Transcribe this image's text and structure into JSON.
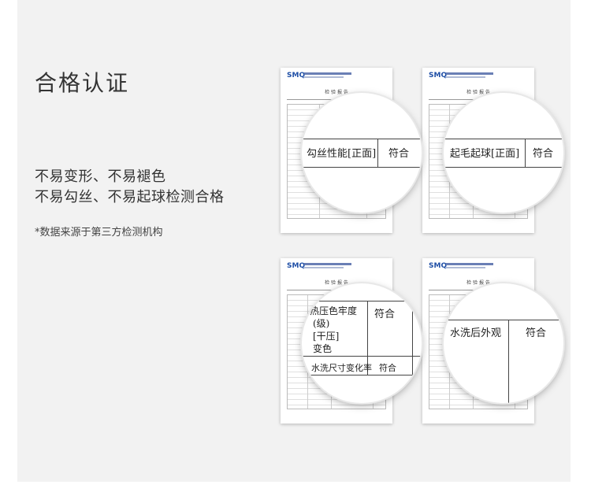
{
  "title": "合格认证",
  "features": [
    "不易变形、不易褪色",
    "不易勾丝、不易起球检测合格"
  ],
  "note": "*数据来源于第三方检测机构",
  "report": {
    "logo": "SMQ",
    "heading": "检 验 报 告"
  },
  "magnified": [
    {
      "item": "勾丝性能[正面]",
      "result": "符合"
    },
    {
      "item": "起毛起球[正面]",
      "result": "符合"
    },
    {
      "item": "热压色牢度",
      "item_sub": "(级)",
      "item_note": "[干压]",
      "item_extra": "变色",
      "result": "符合",
      "item2": "水洗尺寸变化率",
      "result2": "符合"
    },
    {
      "item": "水洗后外观",
      "result": "符合"
    }
  ],
  "colors": {
    "panel_bg": "#f2f2f2",
    "logo_blue": "#1f4fa6",
    "text": "#333333"
  }
}
